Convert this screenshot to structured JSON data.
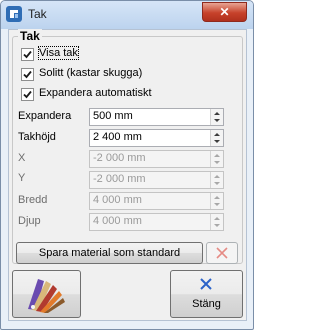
{
  "window": {
    "title": "Tak",
    "close_glyph": "✕"
  },
  "group": {
    "title": "Tak"
  },
  "checkboxes": [
    {
      "label": "Visa tak",
      "checked": true
    },
    {
      "label": "Solitt (kastar skugga)",
      "checked": true
    },
    {
      "label": "Expandera automatiskt",
      "checked": true
    }
  ],
  "fields": [
    {
      "label": "Expandera",
      "value": "500 mm",
      "enabled": true
    },
    {
      "label": "Takhöjd",
      "value": "2 400 mm",
      "enabled": true
    },
    {
      "label": "X",
      "value": "-2 000 mm",
      "enabled": false
    },
    {
      "label": "Y",
      "value": "-2 000 mm",
      "enabled": false
    },
    {
      "label": "Bredd",
      "value": "4 000 mm",
      "enabled": false
    },
    {
      "label": "Djup",
      "value": "4 000 mm",
      "enabled": false
    }
  ],
  "buttons": {
    "save_material": "Spara material som standard",
    "close": "Stäng"
  },
  "icons": {
    "app": "app-logo-icon",
    "delete": "red-x-icon",
    "material": "material-swatches-icon",
    "close": "blue-x-icon"
  },
  "colors": {
    "titlebar": "#bcd3ee",
    "close_button": "#c7422b",
    "delete_x": "#e58a84",
    "stang_x": "#2b63c9"
  }
}
